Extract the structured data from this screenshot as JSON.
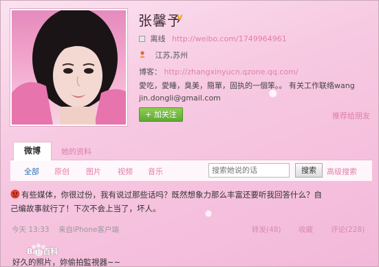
{
  "profile": {
    "name": "张馨予",
    "verified_badge": "v",
    "status": "离线",
    "weibo_url": "http://weibo.com/1749964961",
    "location": "江苏,苏州",
    "blog_label": "博客：",
    "blog_url": "http://zhangxinyucn.qzone.qq.com/",
    "bio_line1": "愛吃，愛睡，臭美，簡單，固执的一個笨。。   有关工作联络wang",
    "bio_line2": "jin.dongli@gmail.com",
    "follow_label": "+ 加关注",
    "recommend_label": "推荐给朋友"
  },
  "tabs": [
    {
      "label": "微博",
      "active": true
    },
    {
      "label": "她的资料",
      "active": false
    }
  ],
  "filters": [
    "全部",
    "原创",
    "图片",
    "视频",
    "音乐"
  ],
  "search": {
    "placeholder": "搜索她说的话",
    "button_label": "搜索",
    "advanced_label": "高级搜索"
  },
  "post": {
    "text_line1": "有些媒体，你很过份，我有说过那些话吗？既然想象力那么丰富还要听我回答什么？自",
    "text_line2": "己编故事就行了！下次不会上当了，坏人。",
    "time": "今天  13:33",
    "source": "来自iPhone客户端",
    "repost": "转发(48)",
    "favorite": "收藏",
    "comment": "评论(228)"
  },
  "caption": "好久的照片，妳偷拍監視器~~",
  "watermark": "Bai 百科",
  "colors": {
    "accent_pink": "#e07fa8",
    "follow_green": "#5ea834",
    "link_blue": "#2b6fb2",
    "background": "#f7c9e2"
  },
  "icons": [
    "status-offline-icon",
    "location-pin-icon",
    "verified-v-icon",
    "angry-face-icon",
    "baidu-paw-icon"
  ]
}
